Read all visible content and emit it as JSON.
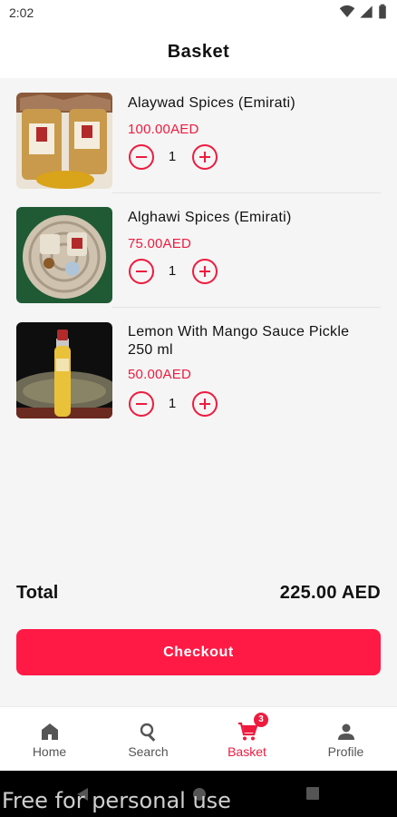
{
  "status_bar": {
    "time": "2:02"
  },
  "header": {
    "title": "Basket"
  },
  "items": [
    {
      "name": "Alaywad Spices (Emirati)",
      "price": "100.00AED",
      "qty": "1"
    },
    {
      "name": "Alghawi Spices (Emirati)",
      "price": "75.00AED",
      "qty": "1"
    },
    {
      "name": "Lemon With Mango Sauce Pickle 250 ml",
      "price": "50.00AED",
      "qty": "1"
    }
  ],
  "summary": {
    "total_label": "Total",
    "total_value": "225.00 AED"
  },
  "checkout_label": "Checkout",
  "nav": {
    "items": [
      {
        "label": "Home",
        "icon": "home-icon"
      },
      {
        "label": "Search",
        "icon": "search-icon"
      },
      {
        "label": "Basket",
        "icon": "cart-icon"
      },
      {
        "label": "Profile",
        "icon": "person-icon"
      }
    ],
    "active": "Basket",
    "badge": "3"
  },
  "watermark": "Free for personal use",
  "colors": {
    "accent": "#ee1b3f",
    "button": "#ff1a45",
    "background": "#f5f5f5"
  }
}
